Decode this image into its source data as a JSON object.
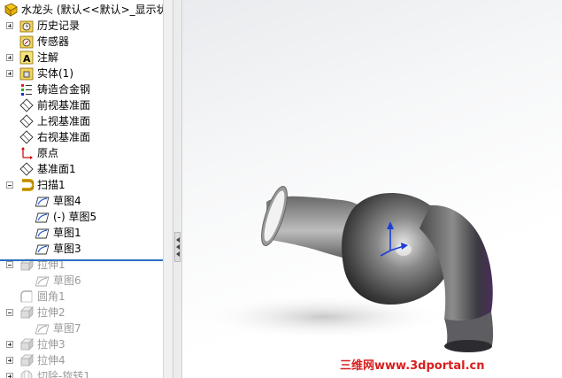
{
  "tree": {
    "items": [
      {
        "label": "水龙头 (默认<<默认>_显示状",
        "icon": "part-icon",
        "expander": "none",
        "indent": 0,
        "dim": false
      },
      {
        "label": "历史记录",
        "icon": "history-folder-icon",
        "expander": "plus",
        "indent": 1,
        "dim": false
      },
      {
        "label": "传感器",
        "icon": "sensor-icon",
        "expander": "none",
        "indent": 1,
        "dim": false
      },
      {
        "label": "注解",
        "icon": "annotation-icon",
        "expander": "plus",
        "indent": 1,
        "dim": false
      },
      {
        "label": "实体(1)",
        "icon": "solid-bodies-icon",
        "expander": "plus",
        "indent": 1,
        "dim": false
      },
      {
        "label": "铸造合金钢",
        "icon": "material-icon",
        "expander": "none",
        "indent": 1,
        "dim": false
      },
      {
        "label": "前视基准面",
        "icon": "plane-icon",
        "expander": "none",
        "indent": 1,
        "dim": false
      },
      {
        "label": "上视基准面",
        "icon": "plane-icon",
        "expander": "none",
        "indent": 1,
        "dim": false
      },
      {
        "label": "右视基准面",
        "icon": "plane-icon",
        "expander": "none",
        "indent": 1,
        "dim": false
      },
      {
        "label": "原点",
        "icon": "origin-icon",
        "expander": "none",
        "indent": 1,
        "dim": false
      },
      {
        "label": "基准面1",
        "icon": "plane-icon",
        "expander": "none",
        "indent": 1,
        "dim": false
      },
      {
        "label": "扫描1",
        "icon": "sweep-icon",
        "expander": "minus",
        "indent": 1,
        "dim": false
      },
      {
        "label": "草图4",
        "icon": "sketch-icon",
        "expander": "none",
        "indent": 2,
        "dim": false
      },
      {
        "label": "(-) 草图5",
        "icon": "sketch-icon",
        "expander": "none",
        "indent": 2,
        "dim": false
      },
      {
        "label": "草图1",
        "icon": "sketch-icon",
        "expander": "none",
        "indent": 2,
        "dim": false
      },
      {
        "label": "草图3",
        "icon": "sketch-icon",
        "expander": "none",
        "indent": 2,
        "dim": false
      },
      {
        "label": "拉伸1",
        "icon": "extrude-icon",
        "expander": "minus",
        "indent": 1,
        "dim": true
      },
      {
        "label": "草图6",
        "icon": "sketch-icon",
        "expander": "none",
        "indent": 2,
        "dim": true
      },
      {
        "label": "圆角1",
        "icon": "fillet-icon",
        "expander": "none",
        "indent": 1,
        "dim": true
      },
      {
        "label": "拉伸2",
        "icon": "extrude-icon",
        "expander": "minus",
        "indent": 1,
        "dim": true
      },
      {
        "label": "草图7",
        "icon": "sketch-icon",
        "expander": "none",
        "indent": 2,
        "dim": true
      },
      {
        "label": "拉伸3",
        "icon": "extrude-icon",
        "expander": "plus",
        "indent": 1,
        "dim": true
      },
      {
        "label": "拉伸4",
        "icon": "extrude-icon",
        "expander": "plus",
        "indent": 1,
        "dim": true
      },
      {
        "label": "切除-旋转1",
        "icon": "cut-revolve-icon",
        "expander": "plus",
        "indent": 1,
        "dim": true
      }
    ]
  },
  "watermark": "三维网www.3dportal.cn",
  "colors": {
    "rollback_bar": "#2a6fc0",
    "watermark": "#d81e1e",
    "axis": "#1f3ed6"
  }
}
